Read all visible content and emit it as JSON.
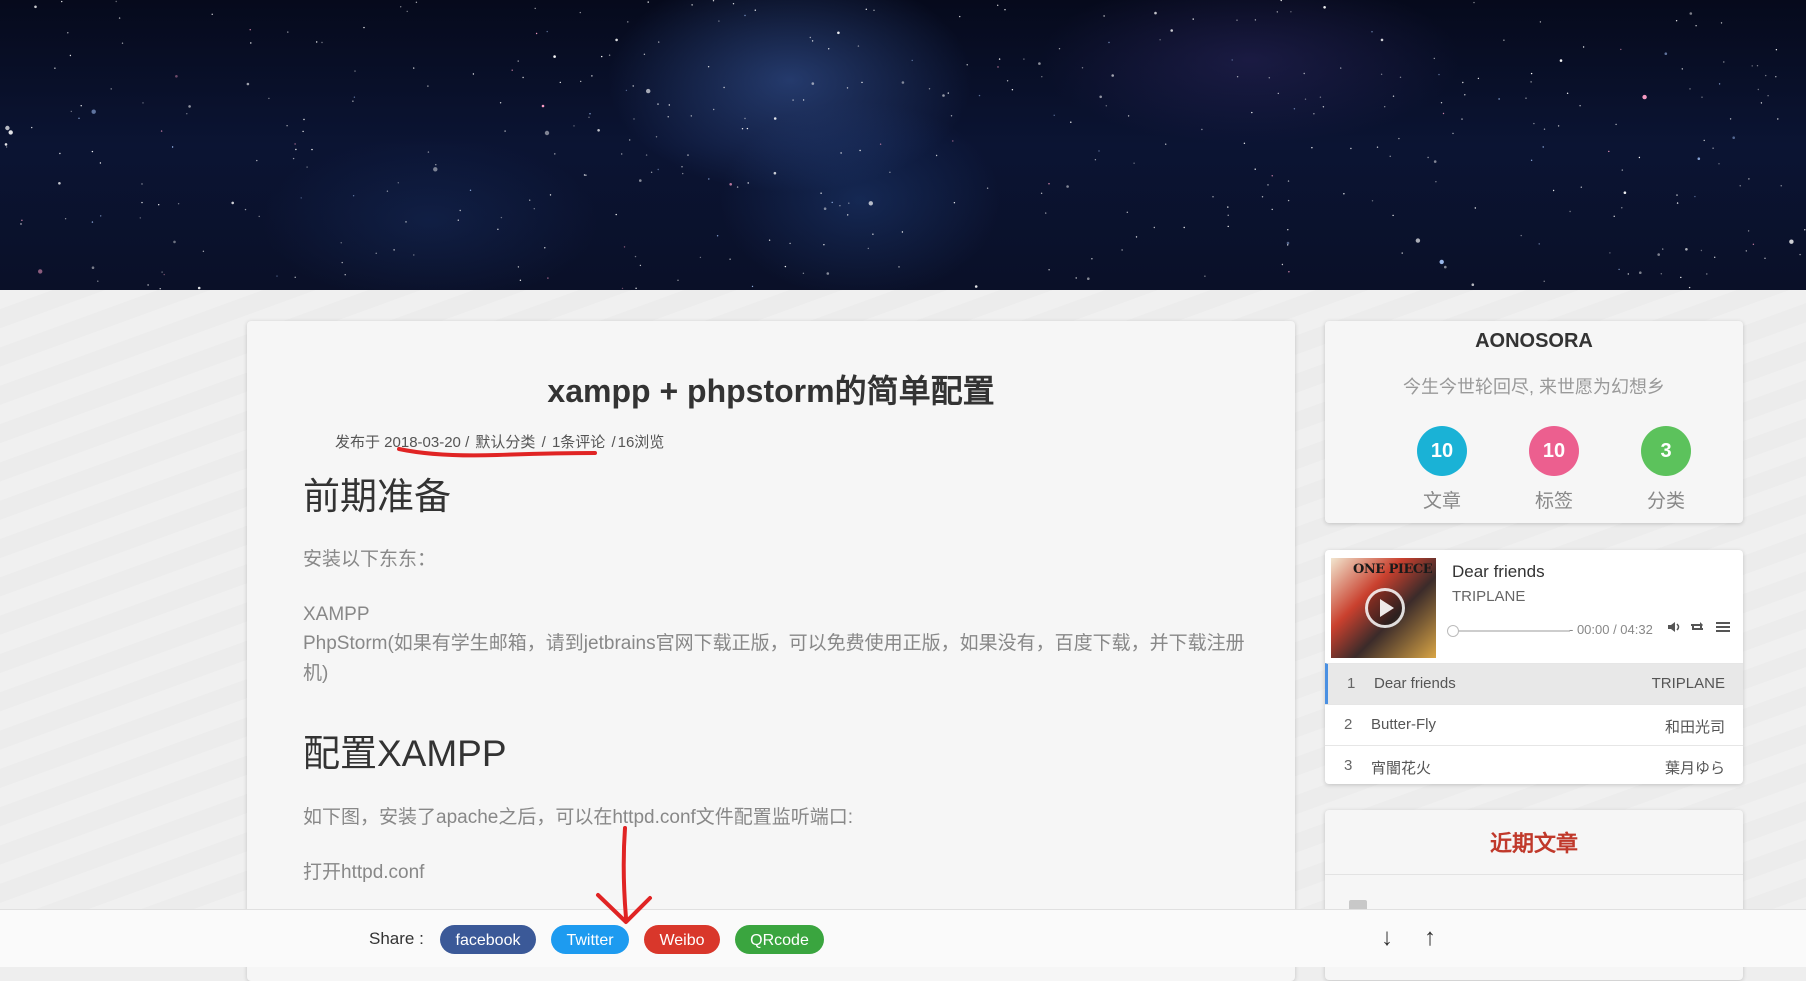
{
  "article": {
    "title": "xampp + phpstorm的简单配置",
    "meta": {
      "prefix": "发布于 2018-03-20 / ",
      "category": "默认分类",
      "sep1": " / ",
      "comments": "1条评论",
      "sep2": " /",
      "views": "16浏览"
    },
    "section1_heading": "前期准备",
    "section1_intro": "安装以下东东：",
    "section1_item1": "XAMPP",
    "section1_item2": "PhpStorm(如果有学生邮箱，请到jetbrains官网下载正版，可以免费使用正版，如果没有，百度下载，并下载注册机)",
    "section2_heading": "配置XAMPP",
    "section2_p1": "如下图，安装了apache之后，可以在httpd.conf文件配置监听端口:",
    "section2_p2": "打开httpd.conf"
  },
  "profile": {
    "name": "AONOSORA",
    "motto": "今生今世轮回尽, 来世愿为幻想乡",
    "stats": [
      {
        "value": "10",
        "label": "文章",
        "color": "#1ab2d6"
      },
      {
        "value": "10",
        "label": "标签",
        "color": "#ec5f8f"
      },
      {
        "value": "3",
        "label": "分类",
        "color": "#5cc25c"
      }
    ]
  },
  "player": {
    "cover_text": "ONE PIECE",
    "current_title": "Dear friends",
    "current_artist": "TRIPLANE",
    "time": "- 00:00 / 04:32",
    "playlist": [
      {
        "num": "1",
        "title": "Dear friends",
        "artist": "TRIPLANE"
      },
      {
        "num": "2",
        "title": "Butter-Fly",
        "artist": "和田光司"
      },
      {
        "num": "3",
        "title": "宵闇花火",
        "artist": "葉月ゆら"
      }
    ]
  },
  "recent": {
    "heading": "近期文章"
  },
  "share": {
    "label": "Share :",
    "buttons": [
      {
        "label": "facebook",
        "color": "#3b5998"
      },
      {
        "label": "Twitter",
        "color": "#1d9bf0"
      },
      {
        "label": "Weibo",
        "color": "#d9372b"
      },
      {
        "label": "QRcode",
        "color": "#3aa53f"
      }
    ],
    "down_arrow": "↓",
    "up_arrow": "↑"
  }
}
